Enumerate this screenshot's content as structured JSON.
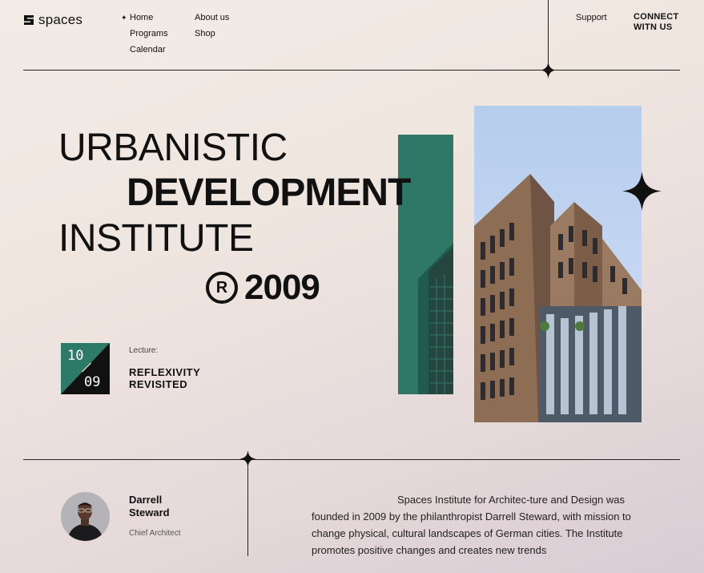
{
  "brand": {
    "name": "spaces"
  },
  "nav": {
    "col1": [
      "Home",
      "Programs",
      "Calendar"
    ],
    "col2": [
      "About us",
      "Shop"
    ],
    "support": "Support",
    "connect": "CONNECT WITN US"
  },
  "hero": {
    "line1": "URBANISTIC",
    "line2": "DEVELOPMENT",
    "line3": "INSTITUTE",
    "reg_symbol": "R",
    "year": "2009"
  },
  "lecture": {
    "day": "10",
    "month": "09",
    "label": "Lecture:",
    "title_line1": "REFLEXIVITY",
    "title_line2": "REVISITED"
  },
  "person": {
    "first_name": "Darrell",
    "last_name": "Steward",
    "role": "Chief Architect"
  },
  "about": {
    "text": "Spaces Institute for Architec-ture and Design was founded in 2009 by the philanthropist Darrell Steward, with mission to change physical, cultural landscapes of German cities. The Institute promotes positive changes and creates new trends"
  },
  "colors": {
    "accent_green": "#2f7868",
    "ink": "#111111"
  },
  "icons": [
    "logo-s-icon",
    "sparkle-icon",
    "nav-star-icon",
    "registered-icon"
  ]
}
